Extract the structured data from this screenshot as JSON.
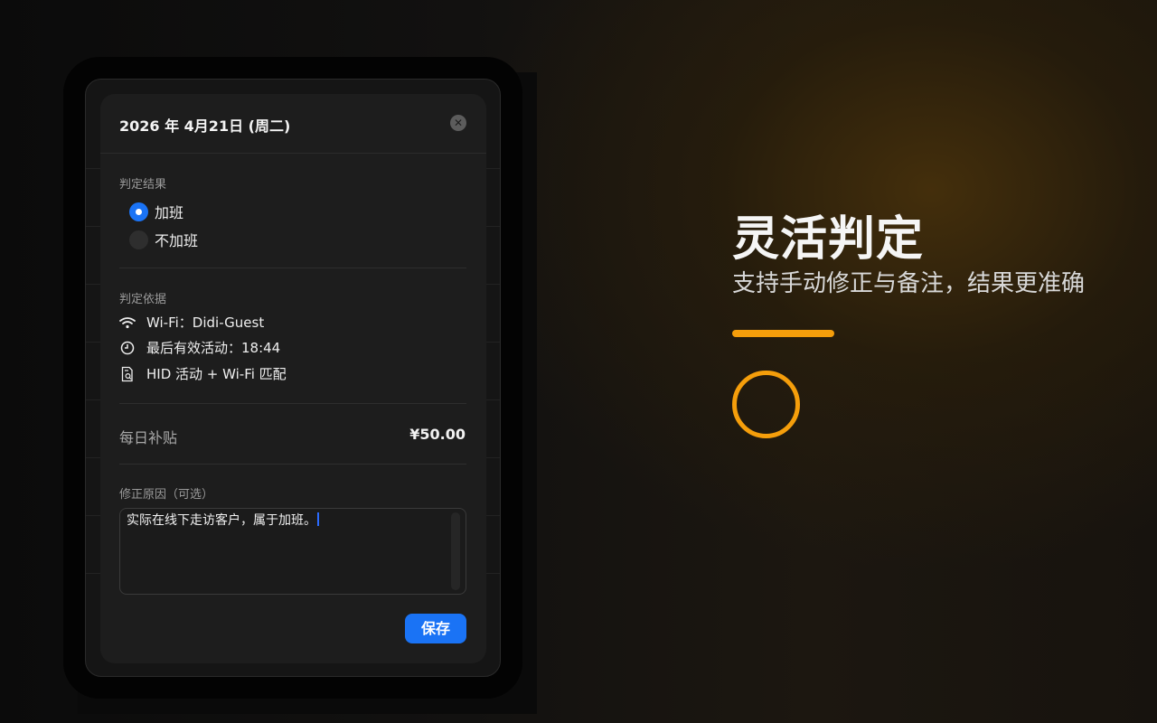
{
  "dialog": {
    "title": "2026 年 4月21日 (周二)",
    "result_label": "判定结果",
    "options": [
      {
        "label": "加班",
        "selected": true
      },
      {
        "label": "不加班",
        "selected": false
      }
    ],
    "basis_label": "判定依据",
    "basis_items": [
      {
        "icon": "wifi-icon",
        "text": "Wi-Fi：Didi-Guest"
      },
      {
        "icon": "clock-icon",
        "text": "最后有效活动：18:44"
      },
      {
        "icon": "document-search-icon",
        "text": "HID 活动 + Wi-Fi 匹配"
      }
    ],
    "subsidy_label": "每日补贴",
    "subsidy_value": "¥50.00",
    "reason_label": "修正原因（可选）",
    "reason_value": "实际在线下走访客户，属于加班。",
    "save_label": "保存"
  },
  "hero": {
    "title": "灵活判定",
    "subtitle": "支持手动修正与备注，结果更准确"
  },
  "colors": {
    "accent": "#1a73f5",
    "highlight": "#f59e0b"
  }
}
